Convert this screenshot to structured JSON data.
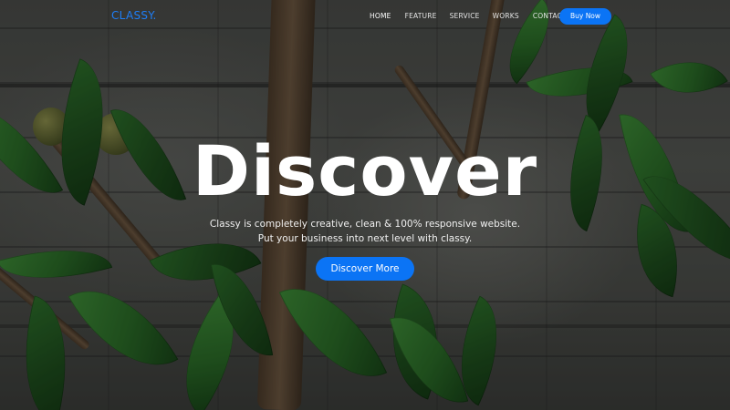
{
  "nav": {
    "brand": "CLASSY.",
    "items": [
      {
        "label": "HOME",
        "active": true
      },
      {
        "label": "FEATURE",
        "active": false
      },
      {
        "label": "SERVICE",
        "active": false
      },
      {
        "label": "WORKS",
        "active": false
      },
      {
        "label": "CONTACT",
        "active": false
      }
    ],
    "cta_label": "Buy Now"
  },
  "hero": {
    "title": "Discover",
    "subtitle_line1": "Classy is completely creative, clean & 100% responsive website.",
    "subtitle_line2": "Put your business into next level with classy.",
    "button_label": "Discover More"
  },
  "colors": {
    "accent": "#0b74f5",
    "brand": "#1e7ef7"
  }
}
